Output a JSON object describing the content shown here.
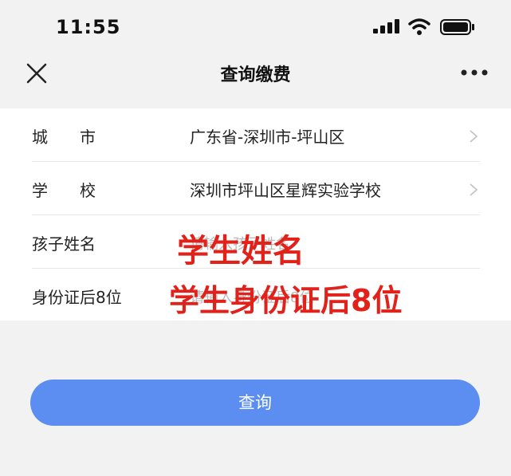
{
  "status_bar": {
    "time": "11:55"
  },
  "nav": {
    "title": "查询缴费"
  },
  "form": {
    "city": {
      "label": "城　　市",
      "value": "广东省-深圳市-坪山区"
    },
    "school": {
      "label": "学　　校",
      "value": "深圳市坪山区星辉实验学校"
    },
    "child_name": {
      "label": "孩子姓名",
      "placeholder": "请输入孩子姓名"
    },
    "id_last8": {
      "label": "身份证后8位",
      "placeholder": "请输入身份证后8位"
    }
  },
  "annotations": {
    "name_note": "学生姓名",
    "id_note": "学生身份证后8位"
  },
  "query_button": {
    "label": "查询"
  },
  "colors": {
    "accent": "#5b8ef0",
    "annotation_red": "#e0221b"
  },
  "icons": [
    "signal-icon",
    "wifi-icon",
    "battery-icon",
    "close-icon",
    "more-icon",
    "chevron-right-icon"
  ]
}
